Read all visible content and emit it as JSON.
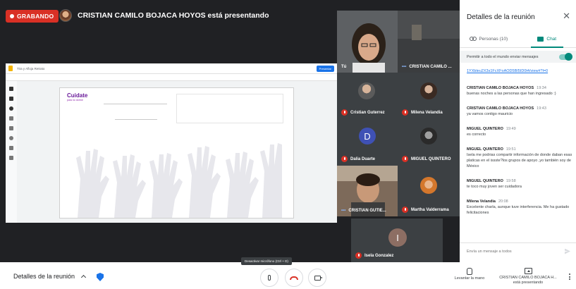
{
  "recording": {
    "label": "GRABANDO"
  },
  "presenter_banner": {
    "text": "CRISTIAN CAMILO BOJACA HOYOS está presentando"
  },
  "shared_screen": {
    "doc_title": "Tira y Afloja Retrato",
    "slide_brand": "Cuidate",
    "slide_brand_sub": "para no dormir",
    "present_label": "Presentar"
  },
  "participants": [
    {
      "name": "Tú",
      "muted": false
    },
    {
      "name": "CRISTIAN CAMILO ...",
      "muted": false,
      "speaking": true
    },
    {
      "name": "Cristian Guterrez",
      "muted": true
    },
    {
      "name": "Milena Velandia",
      "muted": true
    },
    {
      "name": "Dalia Duarte",
      "muted": true,
      "initial": "D",
      "color": "#3f51b5"
    },
    {
      "name": "MIGUEL QUINTERO",
      "muted": true
    },
    {
      "name": "CRISTIAN GUTIE...",
      "muted": false,
      "speaking": true
    },
    {
      "name": "Martha Valderrama",
      "muted": true
    },
    {
      "name": "Isela Gonzalez",
      "muted": true,
      "initial": "I",
      "color": "#8d6e63"
    }
  ],
  "panel": {
    "title": "Detalles de la reunión",
    "tabs": [
      {
        "label": "Personas (10)",
        "icon": "people-icon"
      },
      {
        "label": "Chat",
        "icon": "chat-icon",
        "active": true
      }
    ],
    "allow_messages": "Permitir a todo el mundo enviar mensajes",
    "link": "1YXbleu2X3s1FcXFoAOD5BI5ID0t4/view#?l=0",
    "messages": [
      {
        "author": "CRISTIAN CAMILO BOJACA HOYOS",
        "time": "19:34",
        "text": "buenas noches a las personas que han ingresado :)"
      },
      {
        "author": "CRISTIAN CAMILO BOJACA HOYOS",
        "time": "19:43",
        "text": "ya vamos contigo mauricio"
      },
      {
        "author": "MIGUEL QUINTERO",
        "time": "19:49",
        "text": "es correcto"
      },
      {
        "author": "MIGUEL QUINTERO",
        "time": "19:51",
        "text": "Isela me podrias compartir información de donde daban esas platicas en el issste?los grupos de apoyo ,yo también soy de México"
      },
      {
        "author": "MIGUEL QUINTERO",
        "time": "19:58",
        "text": "te toco muy joven ser cuidadora"
      },
      {
        "author": "Milena Velandia",
        "time": "20:08",
        "text": "Excelente charla, aunque tuve interferencia. Me ha gustado felicitaciones"
      }
    ],
    "input_placeholder": "Envía un mensaje a todos"
  },
  "bottom_bar": {
    "details_label": "Detalles de la reunión",
    "mic_tooltip": "Desactivar micrófono (Ctrl + D)",
    "raise_hand": "Levantar la mano",
    "presenting_name": "CRISTIAN CAMILO BOJACA H...",
    "presenting_status": "está presentando"
  },
  "colors": {
    "record_red": "#d93025",
    "chat_accent": "#00897b",
    "link_blue": "#1a73e8"
  }
}
